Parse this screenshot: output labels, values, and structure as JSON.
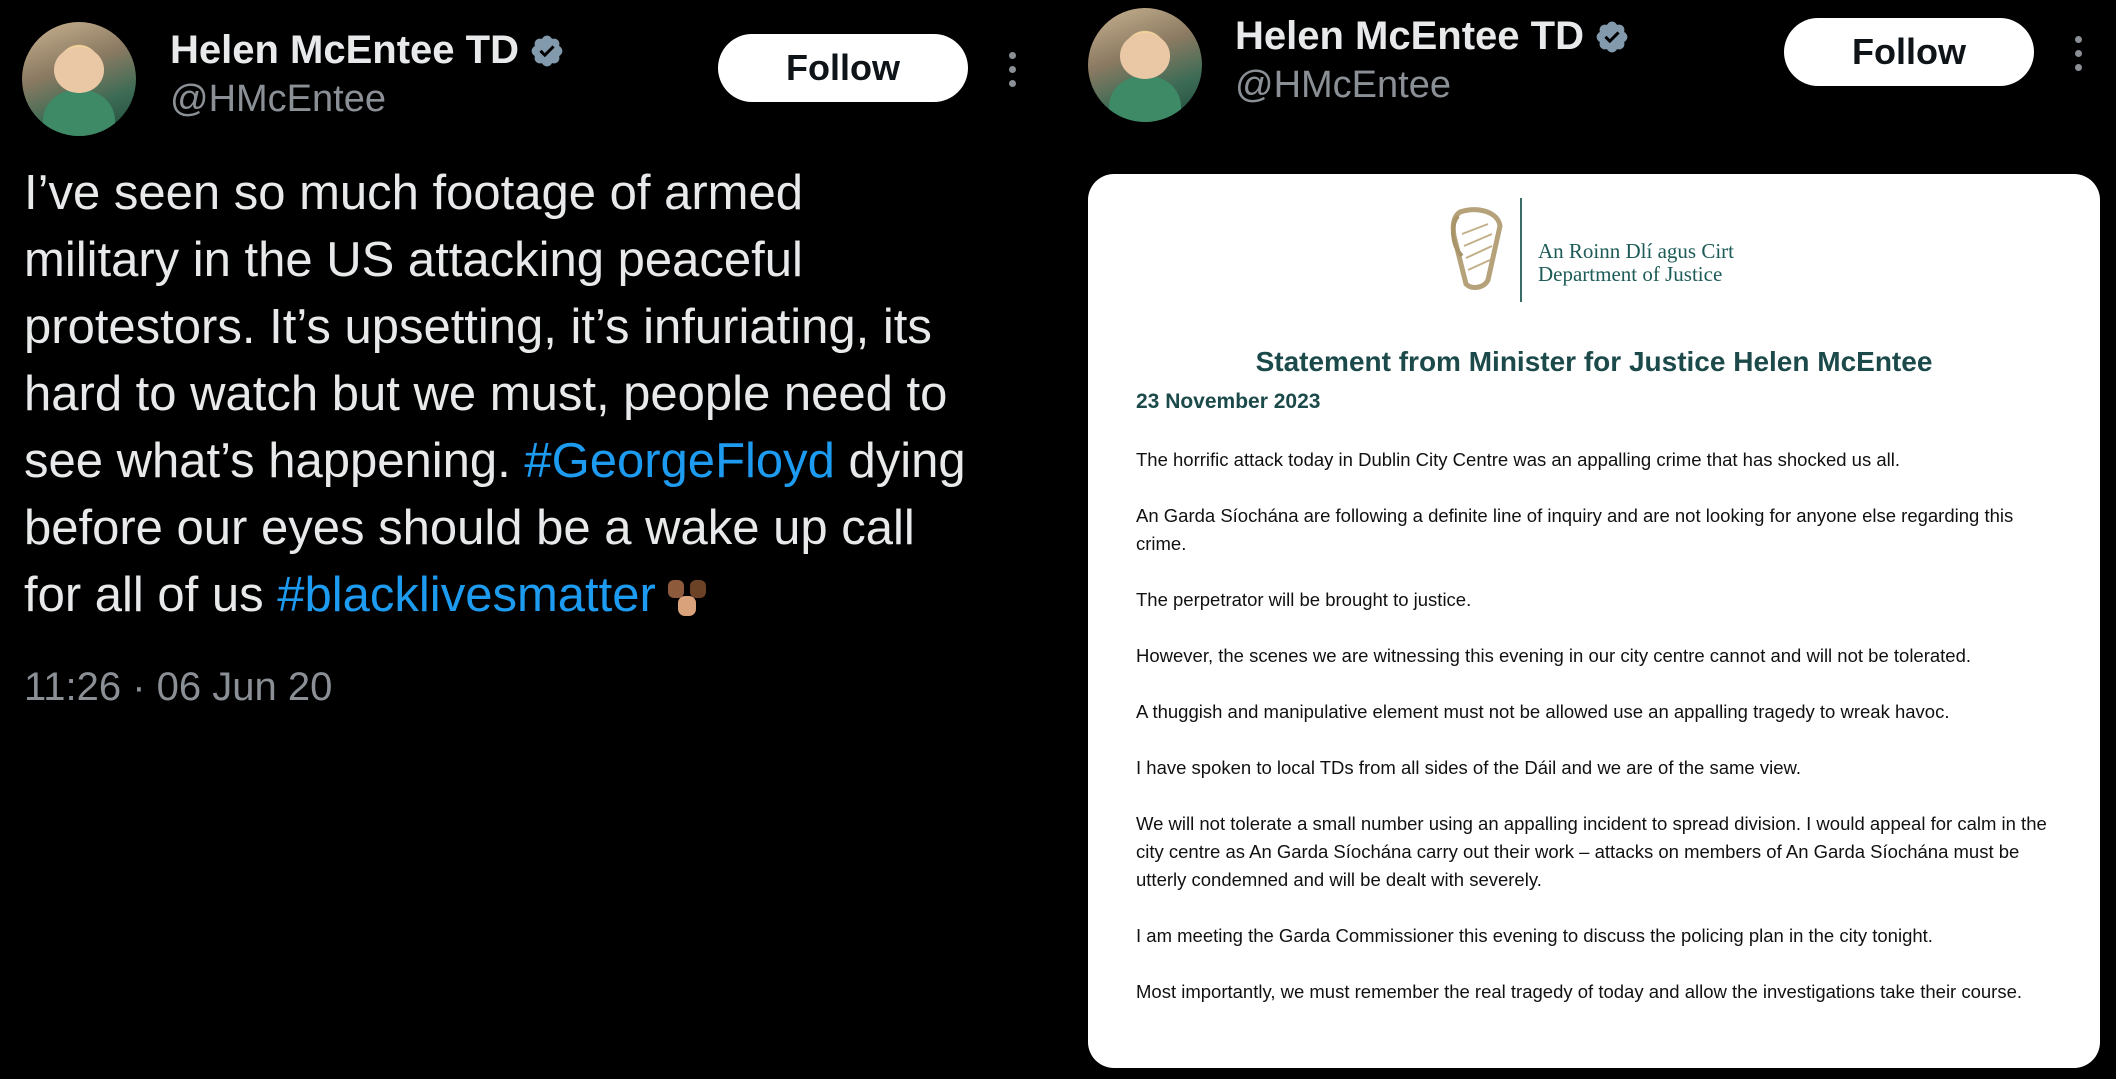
{
  "left_tweet": {
    "author_name": "Helen McEntee TD",
    "handle": "@HMcEntee",
    "follow_label": "Follow",
    "text_lines": [
      [
        {
          "t": "I’ve seen so much footage of armed"
        }
      ],
      [
        {
          "t": "military in the US attacking peaceful"
        }
      ],
      [
        {
          "t": "protestors. It’s upsetting, it’s infuriating, its"
        }
      ],
      [
        {
          "t": "hard to watch but we must, people need to"
        }
      ],
      [
        {
          "t": "see what’s happening. "
        },
        {
          "t": "#GeorgeFloyd",
          "tag": true
        },
        {
          "t": " dying"
        }
      ],
      [
        {
          "t": "before our eyes should be a wake up call"
        }
      ],
      [
        {
          "t": "for all of us "
        },
        {
          "t": "#blacklivesmatter",
          "tag": true
        }
      ]
    ],
    "emoji": "raised-fists-emoji",
    "timestamp": "11:26 · 06 Jun 20"
  },
  "right_tweet": {
    "author_name": "Helen McEntee TD",
    "handle": "@HMcEntee",
    "follow_label": "Follow",
    "document": {
      "department_irish": "An Roinn Dlí agus Cirt",
      "department_english": "Department of Justice",
      "title": "Statement from Minister for Justice Helen McEntee",
      "date": "23 November 2023",
      "paragraphs": [
        "The horrific attack today in Dublin City Centre was an appalling crime that has shocked us all.",
        "An Garda Síochána are following a definite line of inquiry and are not looking for anyone else regarding this crime.",
        "The perpetrator will be brought to justice.",
        "However, the scenes we are witnessing this evening in our city centre cannot and will not be tolerated.",
        "A thuggish and manipulative element must not be allowed use an appalling tragedy to wreak havoc.",
        "I have spoken to local TDs from all sides of the Dáil and we are of the same view.",
        "We will not tolerate a small number using an appalling incident to spread division. I would appeal for calm in the city centre as An Garda Síochána carry out their work – attacks on members of An Garda Síochána must be utterly condemned and will be dealt with severely.",
        "I am meeting the Garda Commissioner this evening to discuss the policing plan in the city tonight.",
        "Most importantly, we must remember the real tragedy of today and allow the investigations take their course."
      ]
    }
  },
  "icons": {
    "verified": "verified-badge-icon",
    "more": "more-options-icon",
    "logo": "harp-logo-icon"
  },
  "colors": {
    "background": "#000000",
    "hashtag": "#1d9bf0",
    "verified_badge": "#829aab",
    "doc_heading": "#1c4a4a"
  }
}
